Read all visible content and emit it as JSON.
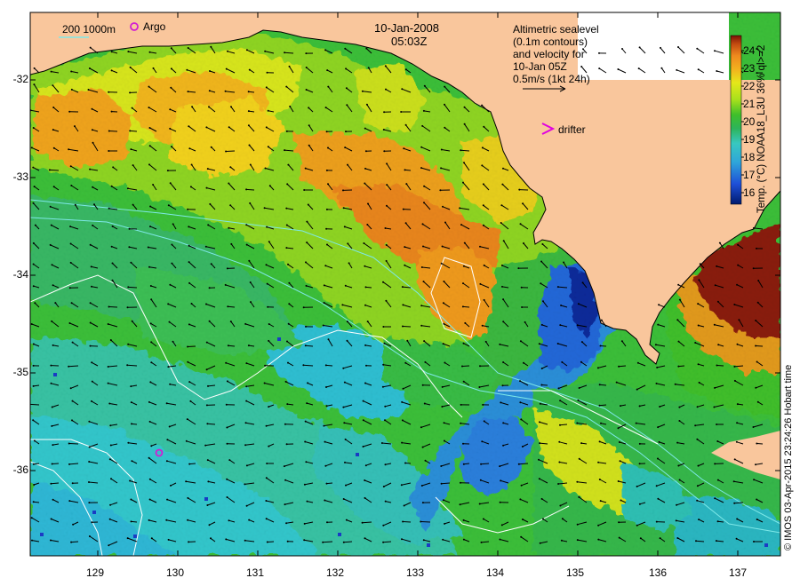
{
  "map": {
    "date": "10-Jan-2008",
    "time": "05:03Z",
    "scale_label": "200  1000m",
    "argo_label": "Argo",
    "drifter_label": "drifter",
    "altimetry_legend": {
      "lines": [
        "Altimetric sealevel",
        "(0.1m contours)",
        "and velocity for",
        "10-Jan 05Z",
        "0.5m/s (1kt 24h)"
      ]
    },
    "colorbar": {
      "label": "Temp. (°C) NOAA18_L3U 36% ql>=2",
      "ticks": [
        "24",
        "23",
        "22",
        "21",
        "20",
        "19",
        "18",
        "17",
        "16"
      ],
      "range": [
        15.3,
        24.8
      ],
      "colors": [
        "#001a6e",
        "#1e4fd8",
        "#2fa6d9",
        "#38c8c0",
        "#2db45a",
        "#3fbf2a",
        "#a8e01c",
        "#e5e81a",
        "#f2b21e",
        "#ef8a1e",
        "#c24a10",
        "#7a1405"
      ]
    },
    "credit": "© IMOS 03-Apr-2015 23:24:26 Hobart time",
    "lat_ticks": [
      "-32",
      "-33",
      "-34",
      "-35",
      "-36"
    ],
    "lon_ticks": [
      "129",
      "130",
      "131",
      "132",
      "133",
      "134",
      "135",
      "136",
      "137"
    ],
    "colors": {
      "land": "#f9c69c",
      "argo": "#d21ed2",
      "drifter": "#e000e0",
      "contour": "#ffffff",
      "bathy": "#7ee8e8"
    }
  }
}
